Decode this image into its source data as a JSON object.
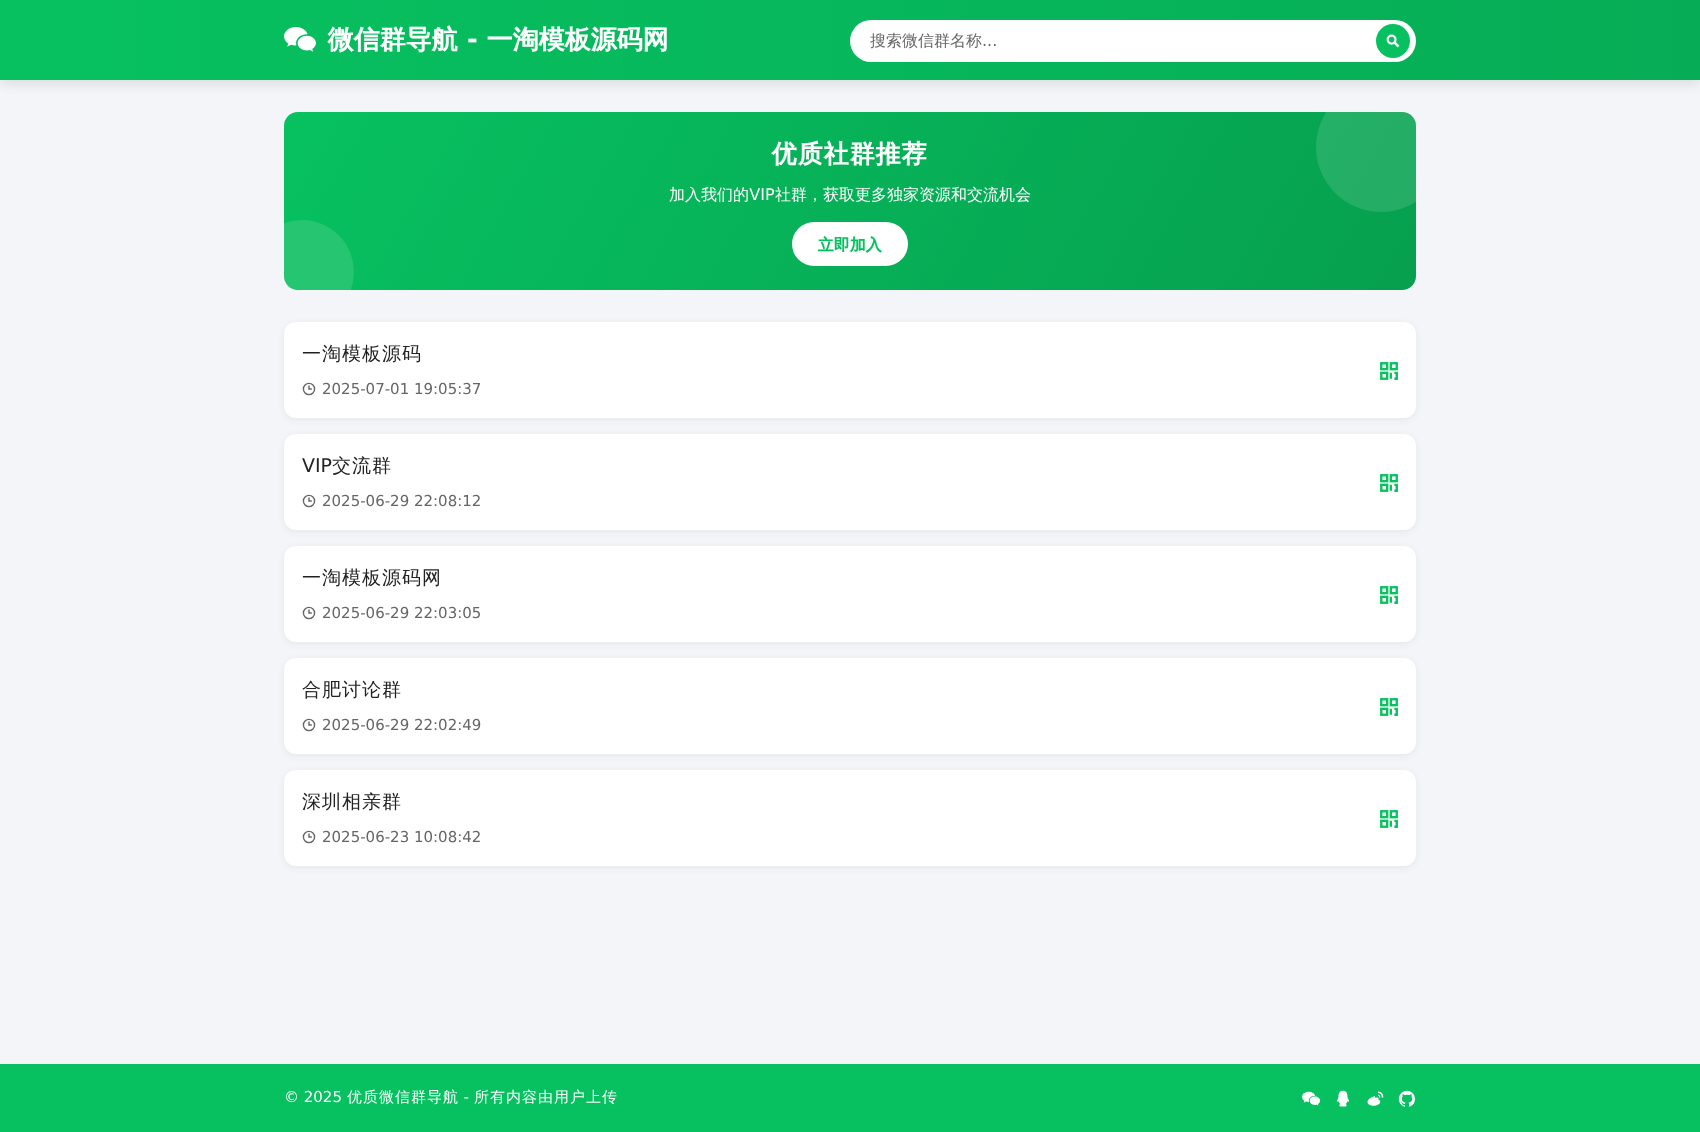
{
  "header": {
    "title": "微信群导航 - 一淘模板源码网",
    "search": {
      "placeholder": "搜索微信群名称..."
    }
  },
  "banner": {
    "title": "优质社群推荐",
    "subtitle": "加入我们的VIP社群，获取更多独家资源和交流机会",
    "button": "立即加入"
  },
  "groups": [
    {
      "name": "一淘模板源码",
      "time": "2025-07-01 19:05:37"
    },
    {
      "name": "VIP交流群",
      "time": "2025-06-29 22:08:12"
    },
    {
      "name": "一淘模板源码网",
      "time": "2025-06-29 22:03:05"
    },
    {
      "name": "合肥讨论群",
      "time": "2025-06-29 22:02:49"
    },
    {
      "name": "深圳相亲群",
      "time": "2025-06-23 10:08:42"
    }
  ],
  "footer": {
    "copyright": "© 2025 优质微信群导航 - 所有内容由用户上传",
    "links": [
      {
        "kind": "wechat"
      },
      {
        "kind": "qq"
      },
      {
        "kind": "weibo"
      },
      {
        "kind": "github"
      }
    ]
  }
}
